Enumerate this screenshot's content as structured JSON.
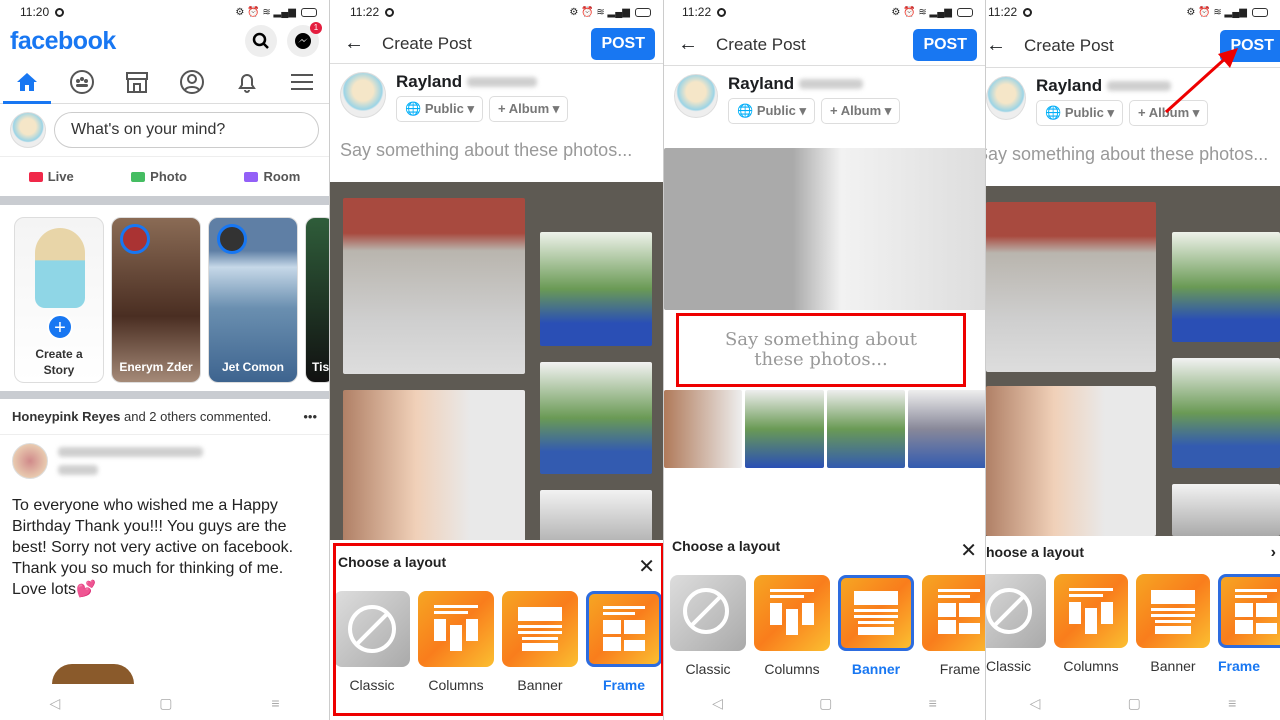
{
  "status": {
    "p1_time": "11:20",
    "p2_time": "11:22",
    "p3_time": "11:22",
    "p4_time": "11:22"
  },
  "feed": {
    "logo": "facebook",
    "messenger_badge": "1",
    "composer_placeholder": "What's on your mind?",
    "actions": [
      {
        "label": "Live",
        "color": "#f02849"
      },
      {
        "label": "Photo",
        "color": "#45bd62"
      },
      {
        "label": "Room",
        "color": "#9360f7"
      }
    ],
    "stories": {
      "create_label_1": "Create a",
      "create_label_2": "Story",
      "items": [
        {
          "name": "Enerym Zder"
        },
        {
          "name": "Jet Comon"
        },
        {
          "name": "Tis"
        }
      ]
    },
    "commented_bold": "Honeypink Reyes",
    "commented_rest": " and 2 others commented.",
    "more": "•••",
    "post_text": "To everyone who wished me a Happy Birthday  Thank you!!! You guys are the best! Sorry not very active on facebook. Thank you so much for thinking of me. Love lots💕"
  },
  "composer": {
    "title": "Create Post",
    "post_label": "POST",
    "user_first": "Rayland",
    "public_label": "Public",
    "album_label": "Album",
    "say_placeholder": "Say something about these photos...",
    "banner_caption": "Say something about these photos...",
    "sheet_title": "Choose a layout",
    "sheet_title_p4": "hoose a layout",
    "layouts": [
      {
        "label": "Classic"
      },
      {
        "label": "Columns"
      },
      {
        "label": "Banner"
      },
      {
        "label": "Frame"
      }
    ],
    "selected_p2": "Frame",
    "selected_p3": "Banner",
    "selected_p4": "Frame"
  },
  "nav": {
    "back": "◁",
    "home": "▢",
    "menu": "≡"
  }
}
